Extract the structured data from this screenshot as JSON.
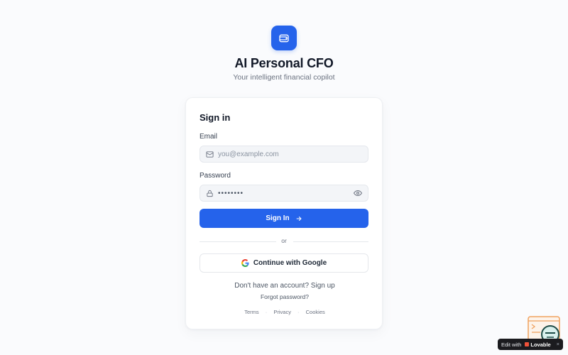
{
  "header": {
    "app_title": "AI Personal CFO",
    "subtitle": "Your intelligent financial copilot",
    "logo_icon": "wallet-icon"
  },
  "signin": {
    "title": "Sign in",
    "email_label": "Email",
    "email_placeholder": "you@example.com",
    "password_label": "Password",
    "password_masked": "••••••••",
    "submit_label": "Sign In",
    "divider_text": "or",
    "google_label": "Continue with Google",
    "no_account_text": "Don't have an account? Sign up",
    "forgot_label": "Forgot password?"
  },
  "footer": {
    "links": [
      "Terms",
      "Privacy",
      "Cookies"
    ],
    "separator": "·"
  },
  "badge": {
    "prefix": "Edit with",
    "brand": "Lovable",
    "close": "×"
  },
  "colors": {
    "primary": "#2563eb",
    "background": "#fafbfd",
    "card": "#ffffff",
    "input_bg": "#f3f5f8"
  }
}
